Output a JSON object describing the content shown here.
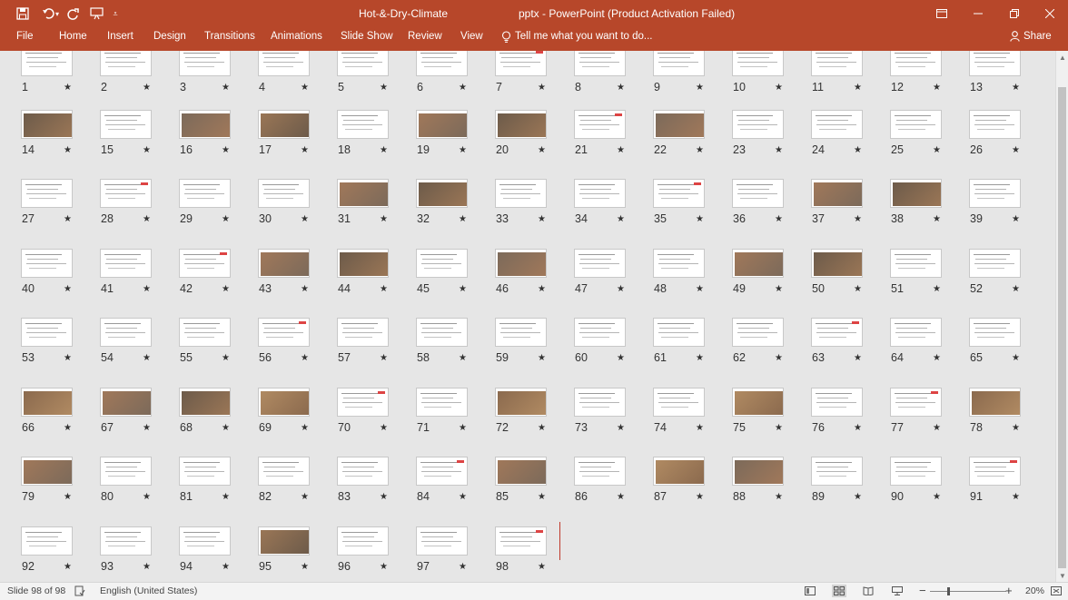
{
  "titlebar": {
    "document": "Hot-&-Dry-Climate",
    "app_title": "pptx - PowerPoint (Product Activation Failed)",
    "accent": "#b7472a"
  },
  "quick_access": {
    "save_icon": "save-icon",
    "undo_icon": "undo-icon",
    "redo_icon": "redo-icon",
    "present_icon": "present-from-beginning-icon",
    "customize_icon": "customize-toolbar-icon"
  },
  "window_controls": {
    "ribbon_display": "ribbon-display-options-icon",
    "minimize": "minimize-icon",
    "restore": "restore-icon",
    "close": "close-icon"
  },
  "ribbon": {
    "tabs": [
      "File",
      "Home",
      "Insert",
      "Design",
      "Transitions",
      "Animations",
      "Slide Show",
      "Review",
      "View"
    ],
    "tell_me": "Tell me what you want to do...",
    "share": "Share"
  },
  "slides": {
    "total": 98,
    "selected": 98,
    "numbers": [
      "1",
      "2",
      "3",
      "4",
      "5",
      "6",
      "7",
      "8",
      "9",
      "10",
      "11",
      "12",
      "13",
      "14",
      "15",
      "16",
      "17",
      "18",
      "19",
      "20",
      "21",
      "22",
      "23",
      "24",
      "25",
      "26",
      "27",
      "28",
      "29",
      "30",
      "31",
      "32",
      "33",
      "34",
      "35",
      "36",
      "37",
      "38",
      "39",
      "40",
      "41",
      "42",
      "43",
      "44",
      "45",
      "46",
      "47",
      "48",
      "49",
      "50",
      "51",
      "52",
      "53",
      "54",
      "55",
      "56",
      "57",
      "58",
      "59",
      "60",
      "61",
      "62",
      "63",
      "64",
      "65",
      "66",
      "67",
      "68",
      "69",
      "70",
      "71",
      "72",
      "73",
      "74",
      "75",
      "76",
      "77",
      "78",
      "79",
      "80",
      "81",
      "82",
      "83",
      "84",
      "85",
      "86",
      "87",
      "88",
      "89",
      "90",
      "91",
      "92",
      "93",
      "94",
      "95",
      "96",
      "97",
      "98"
    ],
    "star": "★",
    "photo_slides": [
      14,
      16,
      17,
      19,
      20,
      22,
      31,
      32,
      37,
      38,
      43,
      44,
      46,
      49,
      50,
      66,
      67,
      68,
      69,
      72,
      75,
      78,
      79,
      85,
      87,
      88,
      95
    ]
  },
  "statusbar": {
    "slide_info": "Slide 98 of 98",
    "language": "English (United States)",
    "zoom": "20%",
    "zoom_level": 0.2
  }
}
